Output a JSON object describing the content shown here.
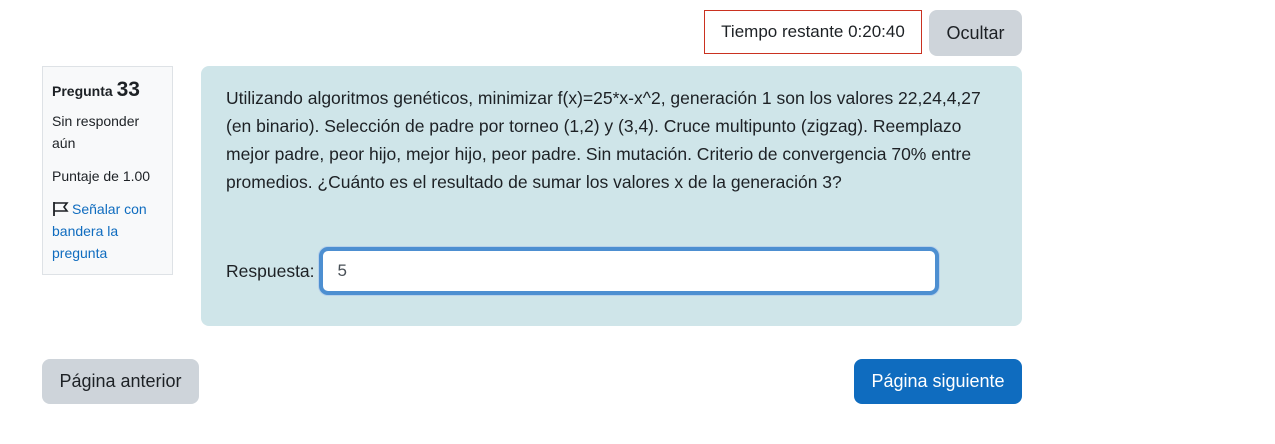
{
  "timer": {
    "label": "Tiempo restante 0:20:40",
    "hide_label": "Ocultar"
  },
  "question_info": {
    "prefix": "Pregunta",
    "number": "33",
    "state": "Sin responder aún",
    "grade": "Puntaje de 1.00",
    "flag_label": "Señalar con bandera la pregunta",
    "flag_icon": "flag-icon"
  },
  "question": {
    "text": "Utilizando algoritmos genéticos, minimizar f(x)=25*x-x^2, generación 1 son los valores 22,24,4,27 (en binario). Selección de padre por torneo (1,2) y (3,4). Cruce multipunto (zigzag). Reemplazo mejor padre, peor hijo, mejor hijo, peor padre. Sin mutación. Criterio de convergencia 70% entre promedios. ¿Cuánto es el resultado de sumar los valores x de la generación 3?",
    "answer_label": "Respuesta:",
    "answer_value": "5"
  },
  "navigation": {
    "prev_label": "Página anterior",
    "next_label": "Página siguiente"
  },
  "colors": {
    "question_bg": "#cfe5e9",
    "primary": "#0f6cbf",
    "secondary": "#ced4da",
    "timer_border": "#ca3120"
  }
}
